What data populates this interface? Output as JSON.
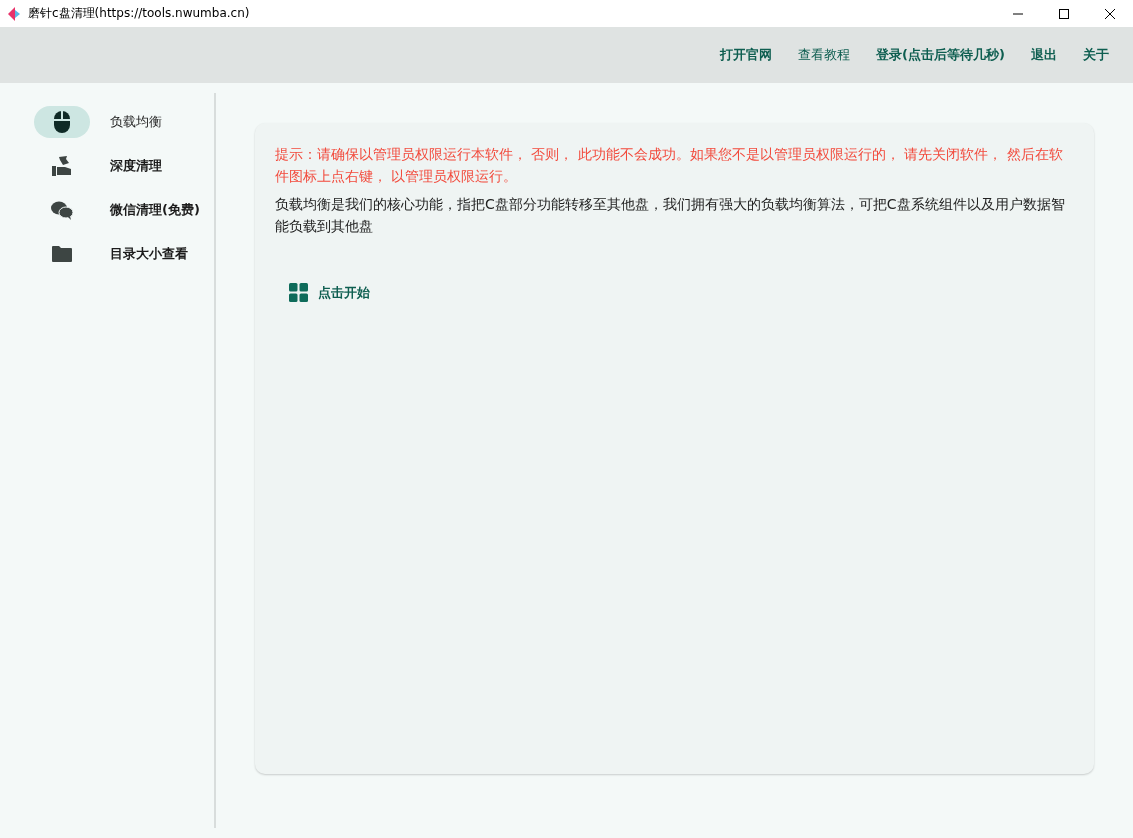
{
  "window": {
    "title": "磨针c盘清理(https://tools.nwumba.cn)"
  },
  "menu": [
    {
      "label": "打开官网"
    },
    {
      "label": "查看教程"
    },
    {
      "label": "登录(点击后等待几秒)"
    },
    {
      "label": "退出"
    },
    {
      "label": "关于"
    }
  ],
  "sidebar": {
    "items": [
      {
        "label": "负载均衡",
        "kind": "mouse",
        "selected": true
      },
      {
        "label": "深度清理",
        "kind": "clean",
        "selected": false
      },
      {
        "label": "微信清理(免费)",
        "kind": "chat",
        "selected": false
      },
      {
        "label": "目录大小查看",
        "kind": "folder",
        "selected": false
      }
    ]
  },
  "content": {
    "warning": "提示：请确保以管理员权限运行本软件， 否则， 此功能不会成功。如果您不是以管理员权限运行的， 请先关闭软件， 然后在软件图标上点右键， 以管理员权限运行。",
    "description": "负载均衡是我们的核心功能，指把C盘部分功能转移至其他盘，我们拥有强大的负载均衡算法，可把C盘系统组件以及用户数据智能负载到其他盘",
    "start_button": "点击开始"
  }
}
